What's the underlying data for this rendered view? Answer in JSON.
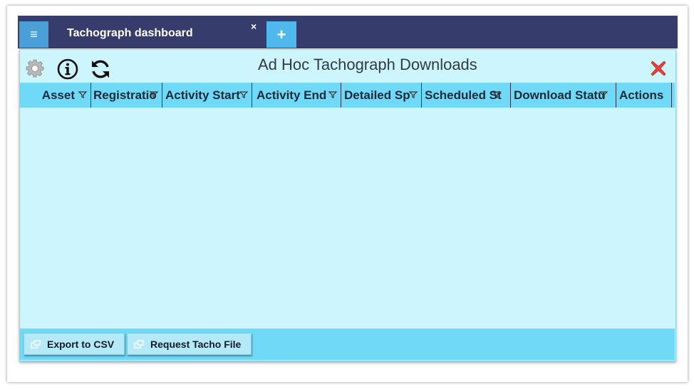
{
  "tab_bar": {
    "menu_icon": "menu-icon",
    "tab_title": "Tachograph dashboard",
    "close_glyph": "×",
    "add_glyph": "+"
  },
  "panel": {
    "title": "Ad Hoc Tachograph Downloads",
    "toolbar_icons": [
      "gear-icon",
      "info-icon",
      "refresh-icon"
    ],
    "close_icon": "close-icon"
  },
  "table": {
    "columns": [
      "Asset",
      "Registratio",
      "Activity Start",
      "Activity End",
      "Detailed Sp",
      "Scheduled St",
      "Download Statu",
      "Actions"
    ],
    "rows": []
  },
  "footer": {
    "export_label": "Export to CSV",
    "request_label": "Request Tacho File"
  },
  "colors": {
    "tab_bar": "#363c6b",
    "menu_button": "#4a9fd8",
    "add_tab": "#4fb8ec",
    "panel_bg": "#ccf5fd",
    "header_bg": "#6fd9f7",
    "close_red": "#e8413a"
  }
}
